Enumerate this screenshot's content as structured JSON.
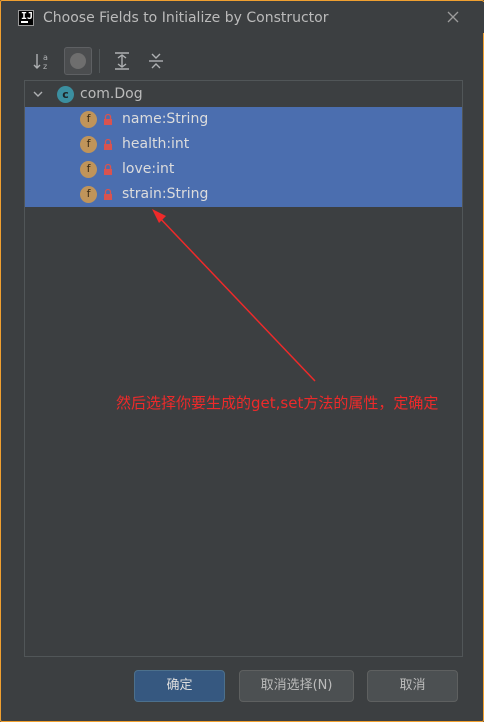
{
  "window": {
    "title": "Choose Fields to Initialize by Constructor",
    "app_icon_text": "IJ"
  },
  "toolbar": {
    "buttons": [
      {
        "icon": "sort-alphabetically-icon"
      },
      {
        "icon": "show-fields-toggle-icon",
        "active": true
      },
      {
        "icon": "expand-all-icon"
      },
      {
        "icon": "collapse-all-icon"
      }
    ]
  },
  "tree": {
    "root": {
      "class_icon_letter": "c",
      "label": "com.Dog",
      "expanded": true
    },
    "fields": [
      {
        "icon_letter": "f",
        "label": "name:String",
        "selected": true
      },
      {
        "icon_letter": "f",
        "label": "health:int",
        "selected": true
      },
      {
        "icon_letter": "f",
        "label": "love:int",
        "selected": true
      },
      {
        "icon_letter": "f",
        "label": "strain:String",
        "selected": true
      }
    ]
  },
  "annotation": {
    "text": "然后选择你要生成的get,set方法的属性，定确定",
    "color": "#ee2a2a"
  },
  "buttons": {
    "ok": "确定",
    "deselect": "取消选择(N)",
    "cancel": "取消"
  },
  "colors": {
    "selection": "#4b6eaf",
    "accent_border": "#f0a030",
    "background": "#3c3f41"
  }
}
